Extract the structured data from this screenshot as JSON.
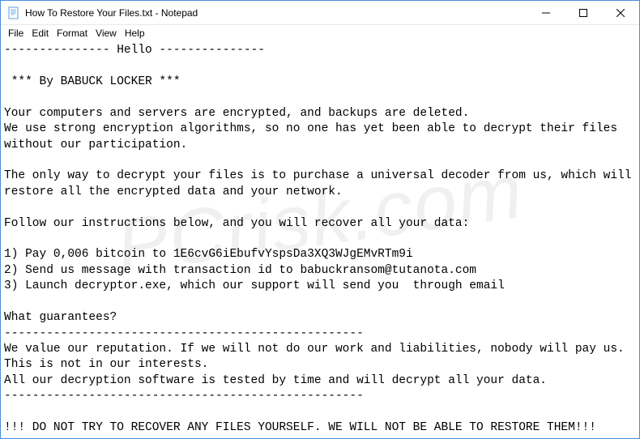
{
  "titlebar": {
    "title": "How To Restore Your Files.txt - Notepad"
  },
  "menubar": {
    "file": "File",
    "edit": "Edit",
    "format": "Format",
    "view": "View",
    "help": "Help"
  },
  "content": {
    "text": "--------------- Hello ---------------\n\n *** By BABUCK LOCKER ***\n\nYour computers and servers are encrypted, and backups are deleted.\nWe use strong encryption algorithms, so no one has yet been able to decrypt their files without our participation.\n\nThe only way to decrypt your files is to purchase a universal decoder from us, which will restore all the encrypted data and your network.\n\nFollow our instructions below, and you will recover all your data:\n\n1) Pay 0,006 bitcoin to 1E6cvG6iEbufvYspsDa3XQ3WJgEMvRTm9i\n2) Send us message with transaction id to babuckransom@tutanota.com\n3) Launch decryptor.exe, which our support will send you  through email\n\nWhat guarantees?\n---------------------------------------------------\nWe value our reputation. If we will not do our work and liabilities, nobody will pay us. This is not in our interests.\nAll our decryption software is tested by time and will decrypt all your data.\n---------------------------------------------------\n\n!!! DO NOT TRY TO RECOVER ANY FILES YOURSELF. WE WILL NOT BE ABLE TO RESTORE THEM!!!"
  },
  "watermark": {
    "text": "PCrisk.com"
  }
}
